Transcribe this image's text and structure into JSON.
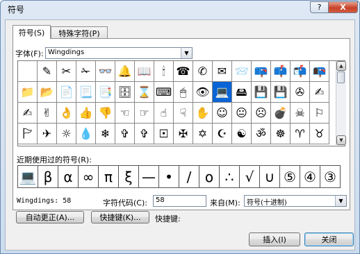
{
  "window": {
    "title": "符号",
    "help_label": "?",
    "close_label": "X"
  },
  "tabs": [
    {
      "label": "符号(S)",
      "active": true
    },
    {
      "label": "特殊字符(P)",
      "active": false
    }
  ],
  "font": {
    "label": "字体(F):",
    "value": "Wingdings"
  },
  "symbol_grid": {
    "selected_index": 10,
    "rows": [
      [
        "",
        "✎",
        "✂",
        "✁",
        "👓",
        "🔔",
        "📖",
        "🕯",
        "☎",
        "✆",
        "✉",
        "📨",
        "📪",
        "📫",
        "📬",
        "📭"
      ],
      [
        "📁",
        "📂",
        "📄",
        "📃",
        "📑",
        "🗄",
        "⌛",
        "⌨",
        "🖱",
        "👁",
        "💻",
        "🖴",
        "💾",
        "💾",
        "✇",
        "✍"
      ],
      [
        "✍",
        "✌",
        "👌",
        "👍",
        "👎",
        "☜",
        "☞",
        "☝",
        "☟",
        "✋",
        "☺",
        "😐",
        "☹",
        "💣",
        "☠",
        "⚐"
      ],
      [
        "🏱",
        "✈",
        "☼",
        "💧",
        "❄",
        "✞",
        "✞",
        "🞔",
        "✠",
        "✡",
        "☪",
        "☯",
        "ॐ",
        "☸",
        "♈",
        "♉"
      ]
    ]
  },
  "recent": {
    "label": "近期使用过的符号(R):",
    "symbols": [
      "💻",
      "β",
      "α",
      "∞",
      "π",
      "ξ",
      "—",
      "•",
      "/",
      "ο",
      "∴",
      "√",
      "∪",
      "⑤",
      "④",
      "③"
    ]
  },
  "info": {
    "font_code": "Wingdings: 58"
  },
  "char_code": {
    "label": "字符代码(C):",
    "value": "58"
  },
  "from": {
    "label": "来自(M):",
    "value": "符号(十进制)"
  },
  "buttons": {
    "autocorrect": "自动更正(A)...",
    "shortcut_key": "快捷键(K)...",
    "shortcut_label": "快捷键:",
    "insert": "插入(I)",
    "close": "关闭"
  }
}
